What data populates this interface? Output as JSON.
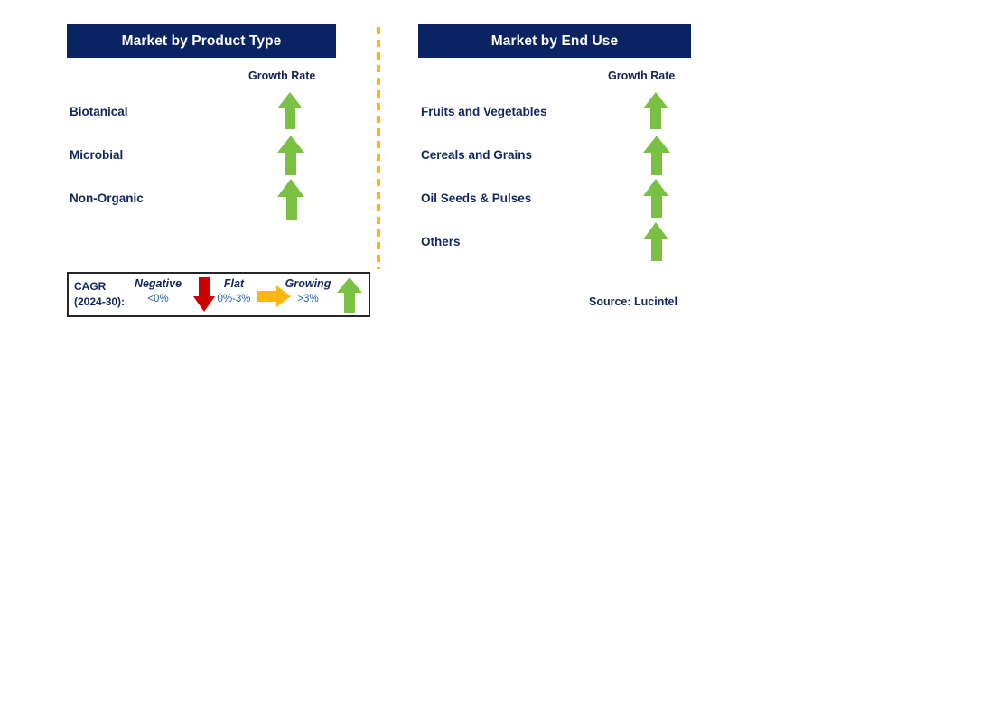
{
  "colors": {
    "header_navy": "#0a2362",
    "label_navy": "#12275e",
    "growing_green": "#7ac143",
    "negative_red": "#cc0000",
    "flat_orange": "#ffb511",
    "divider_orange": "#ffb511",
    "range_blue": "#1f5fa8"
  },
  "panels": [
    {
      "id": "product-type",
      "title": "Market by Product Type",
      "growth_rate_label": "Growth Rate",
      "rows": [
        {
          "label": "Biotanical",
          "growth": "growing",
          "arrow": "up-arrow-icon",
          "size": 28
        },
        {
          "label": "Microbial",
          "growth": "growing",
          "arrow": "up-arrow-icon",
          "size": 30
        },
        {
          "label": "Non-Organic",
          "growth": "growing",
          "arrow": "up-arrow-icon",
          "size": 31
        }
      ]
    },
    {
      "id": "end-use",
      "title": "Market by End Use",
      "growth_rate_label": "Growth Rate",
      "rows": [
        {
          "label": "Fruits and Vegetables",
          "growth": "growing",
          "arrow": "up-arrow-icon",
          "size": 28
        },
        {
          "label": "Cereals and Grains",
          "growth": "growing",
          "arrow": "up-arrow-icon",
          "size": 30
        },
        {
          "label": "Oil Seeds & Pulses",
          "growth": "growing",
          "arrow": "up-arrow-icon",
          "size": 29
        },
        {
          "label": "Others",
          "growth": "growing",
          "arrow": "up-arrow-icon",
          "size": 29
        }
      ]
    }
  ],
  "legend": {
    "cagr_line1": "CAGR",
    "cagr_line2": "(2024-30):",
    "items": [
      {
        "title": "Negative",
        "range": "<0%",
        "icon": "down-arrow-icon"
      },
      {
        "title": "Flat",
        "range": "0%-3%",
        "icon": "right-arrow-icon"
      },
      {
        "title": "Growing",
        "range": ">3%",
        "icon": "up-arrow-icon"
      }
    ]
  },
  "source": "Source: Lucintel",
  "chart_data": {
    "type": "table",
    "title": "Market by Product Type and Market by End Use — Growth Rate",
    "legend_position": "bottom-left",
    "legend": [
      {
        "label": "Negative",
        "range": "<0%",
        "color": "#cc0000"
      },
      {
        "label": "Flat",
        "range": "0%-3%",
        "color": "#ffb511"
      },
      {
        "label": "Growing",
        "range": ">3%",
        "color": "#7ac143"
      }
    ],
    "annotations": [
      "CAGR (2024-30):",
      "Source: Lucintel"
    ],
    "series": [
      {
        "name": "Market by Product Type",
        "categories": [
          "Biotanical",
          "Microbial",
          "Non-Organic"
        ],
        "values": [
          "Growing",
          "Growing",
          "Growing"
        ]
      },
      {
        "name": "Market by End Use",
        "categories": [
          "Fruits and Vegetables",
          "Cereals and Grains",
          "Oil Seeds & Pulses",
          "Others"
        ],
        "values": [
          "Growing",
          "Growing",
          "Growing",
          "Growing"
        ]
      }
    ]
  }
}
